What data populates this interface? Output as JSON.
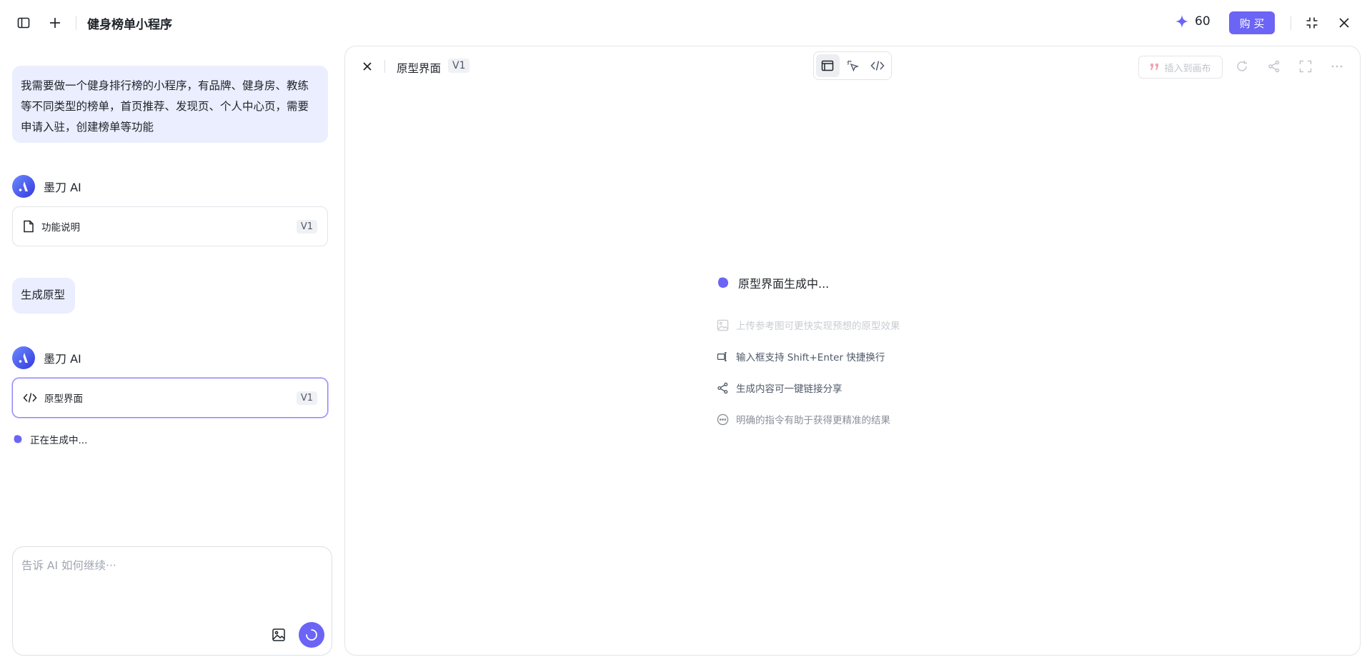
{
  "app": {
    "title": "健身榜单小程序"
  },
  "topbar": {
    "credits": "60",
    "buy_label": "购 买"
  },
  "chat": {
    "user_message_1": "我需要做一个健身排行榜的小程序，有品牌、健身房、教练等不同类型的榜单，首页推荐、发现页、个人中心页，需要申请入驻，创建榜单等功能",
    "ai_name": "墨刀 AI",
    "card_1": {
      "label": "功能说明",
      "version": "V1"
    },
    "user_message_2": "生成原型",
    "card_2": {
      "label": "原型界面",
      "version": "V1"
    },
    "status": "正在生成中..."
  },
  "input": {
    "placeholder": "告诉 AI 如何继续···"
  },
  "panel": {
    "title": "原型界面",
    "version": "V1",
    "insert_label": "插入到画布",
    "generating": "原型界面生成中...",
    "tips": [
      "上传参考图可更快实现预想的原型效果",
      "输入框支持 Shift+Enter 快捷换行",
      "生成内容可一键链接分享",
      "明确的指令有助于获得更精准的结果"
    ]
  },
  "colors": {
    "accent": "#6b64f5",
    "bubble": "#eaeefe"
  }
}
